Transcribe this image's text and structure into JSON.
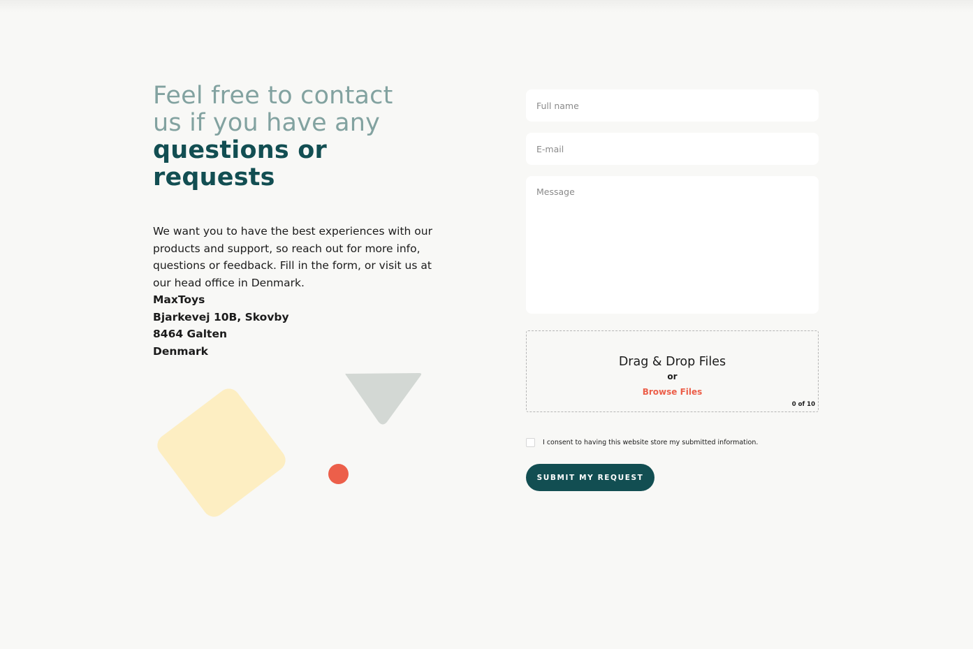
{
  "heading": {
    "line1": "Feel free to contact",
    "line2": "us if you have any",
    "line3": "questions or requests"
  },
  "intro": "We want you to have the best experiences with our products and support, so reach out for more info, questions or feedback. Fill in the form, or visit us at our head office in Denmark.",
  "address": {
    "company": "MaxToys",
    "street": "Bjarkevej 10B, Skovby",
    "city": "8464 Galten",
    "country": "Denmark"
  },
  "form": {
    "fullname_placeholder": "Full name",
    "email_placeholder": "E-mail",
    "message_placeholder": "Message",
    "dropzone": {
      "title": "Drag & Drop Files",
      "or": "or",
      "browse": "Browse Files",
      "count": "0 of 10"
    },
    "consent": "I consent to having this website store my submitted information.",
    "submit": "SUBMIT MY REQUEST"
  },
  "colors": {
    "heading_light": "#82a2a0",
    "heading_dark": "#124e52",
    "accent": "#ec5f4a",
    "shape_yellow": "#fdeec2",
    "shape_gray": "#d3d8d4"
  }
}
